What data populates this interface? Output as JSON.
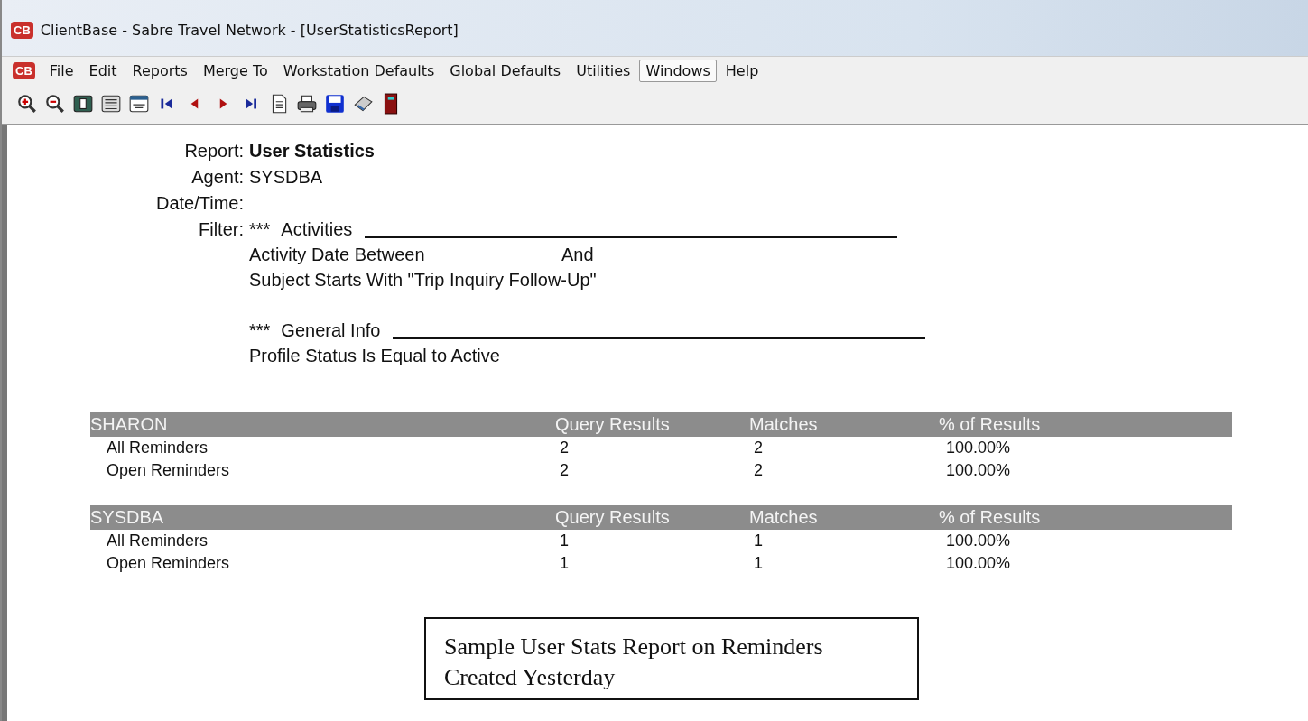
{
  "window": {
    "title": "ClientBase - Sabre Travel Network - [UserStatisticsReport]",
    "app_badge": "CB"
  },
  "menu": {
    "badge": "CB",
    "items": [
      {
        "label": "File",
        "selected": false
      },
      {
        "label": "Edit",
        "selected": false
      },
      {
        "label": "Reports",
        "selected": false
      },
      {
        "label": "Merge To",
        "selected": false
      },
      {
        "label": "Workstation Defaults",
        "selected": false
      },
      {
        "label": "Global Defaults",
        "selected": false
      },
      {
        "label": "Utilities",
        "selected": false
      },
      {
        "label": "Windows",
        "selected": true
      },
      {
        "label": "Help",
        "selected": false
      }
    ]
  },
  "report": {
    "fields": [
      {
        "label": "Report:",
        "value": "User Statistics",
        "kind": "bold"
      },
      {
        "label": "Agent:",
        "value": "SYSDBA",
        "kind": "plain"
      },
      {
        "label": "Date/Time:",
        "kind": "plain"
      }
    ],
    "filter_label": "Filter:",
    "filter_lines": [
      {
        "kind": "section",
        "marks": "***",
        "text": "Activities"
      },
      {
        "kind": "between",
        "text": "Activity Date Between",
        "joiner": "And"
      },
      {
        "kind": "text",
        "text": "Subject Starts With \"Trip Inquiry Follow-Up\""
      },
      {
        "kind": "gap"
      },
      {
        "kind": "section",
        "marks": "***",
        "text": "General Info"
      },
      {
        "kind": "text",
        "text": "Profile Status Is Equal to Active"
      }
    ]
  },
  "groups": [
    {
      "agent": "SHARON",
      "columns": [
        "Query Results",
        "Matches",
        "% of Results"
      ],
      "rows": [
        {
          "name": "All Reminders",
          "query_results": "2",
          "matches": "2",
          "percent": "100.00%"
        },
        {
          "name": "Open Reminders",
          "query_results": "2",
          "matches": "2",
          "percent": "100.00%"
        }
      ]
    },
    {
      "agent": "SYSDBA",
      "columns": [
        "Query Results",
        "Matches",
        "% of Results"
      ],
      "rows": [
        {
          "name": "All Reminders",
          "query_results": "1",
          "matches": "1",
          "percent": "100.00%"
        },
        {
          "name": "Open Reminders",
          "query_results": "1",
          "matches": "1",
          "percent": "100.00%"
        }
      ]
    }
  ],
  "caption": {
    "lines": [
      "Sample User Stats Report on Reminders",
      "Created Yesterday"
    ]
  }
}
